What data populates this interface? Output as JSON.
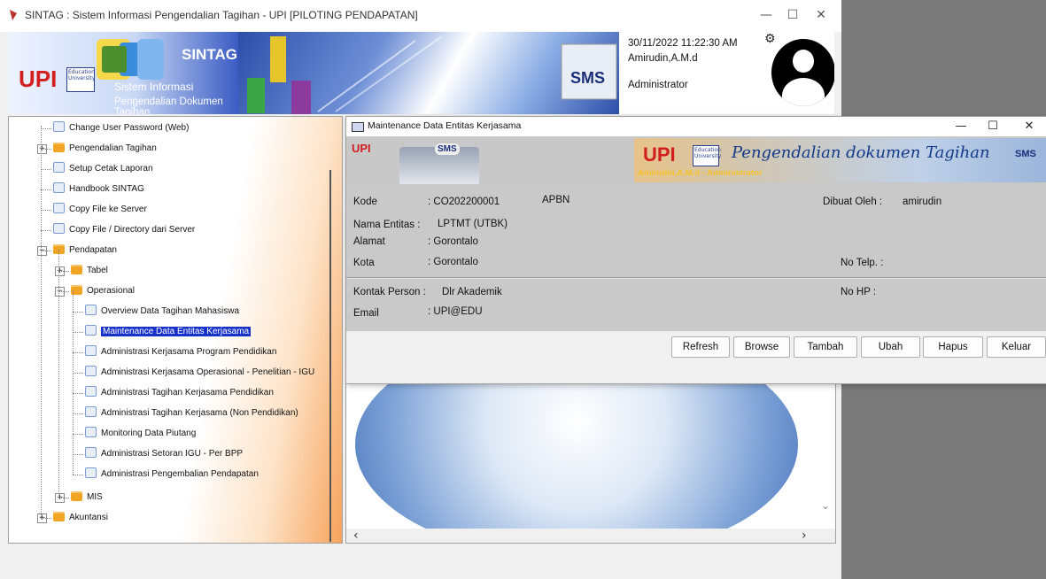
{
  "window": {
    "title": "SINTAG : Sistem Informasi Pengendalian Tagihan - UPI [PILOTING PENDAPATAN]",
    "minimize": "—",
    "maximize": "☐",
    "close": "✕"
  },
  "header": {
    "brand": "SINTAG",
    "upi_logo": "UPI",
    "upi_logo_sub": "Education University",
    "sub1": "Sistem Informasi",
    "sub2": "Pengendalian Dokumen Tagihan",
    "datetime": "30/11/2022 11:22:30 AM",
    "user": "Amirudin,A.M.d",
    "role": "Administrator",
    "gear_icon": "gear-icon",
    "avatar_icon": "user-avatar-icon"
  },
  "tree": {
    "items": [
      {
        "label": "Change User Password (Web)",
        "type": "page"
      },
      {
        "label": "Pengendalian Tagihan",
        "type": "folder",
        "expander": "+"
      },
      {
        "label": "Setup Cetak Laporan",
        "type": "page"
      },
      {
        "label": "Handbook SINTAG",
        "type": "page"
      },
      {
        "label": "Copy File ke Server",
        "type": "page"
      },
      {
        "label": "Copy File / Directory dari Server",
        "type": "page"
      },
      {
        "label": "Pendapatan",
        "type": "folder",
        "expander": "−"
      },
      {
        "label": "Tabel",
        "type": "folder",
        "expander": "+"
      },
      {
        "label": "Operasional",
        "type": "folder",
        "expander": "−"
      },
      {
        "label": "Overview Data Tagihan Mahasiswa",
        "type": "page"
      },
      {
        "label": "Maintenance Data Entitas Kerjasama",
        "type": "page",
        "selected": true
      },
      {
        "label": "Administrasi Kerjasama Program Pendidikan",
        "type": "page"
      },
      {
        "label": "Administrasi Kerjasama Operasional - Penelitian - IGU",
        "type": "page"
      },
      {
        "label": "Administrasi Tagihan Kerjasama Pendidikan",
        "type": "page"
      },
      {
        "label": "Administrasi Tagihan Kerjasama (Non Pendidikan)",
        "type": "page"
      },
      {
        "label": "Monitoring Data Piutang",
        "type": "page"
      },
      {
        "label": "Administrasi Setoran IGU - Per BPP",
        "type": "page"
      },
      {
        "label": "Administrasi Pengembalian Pendapatan",
        "type": "page"
      },
      {
        "label": "MIS",
        "type": "folder",
        "expander": "+"
      },
      {
        "label": "Akuntansi",
        "type": "folder",
        "expander": "+"
      }
    ]
  },
  "dialog": {
    "title": "Maintenance Data Entitas Kerjasama",
    "minimize": "—",
    "maximize": "☐",
    "close": "✕",
    "banner": {
      "upi_logo": "UPI",
      "upi_logo_sub": "Education University",
      "sms_logo": "SMS",
      "tagline": "Pengendalian dokumen Tagihan",
      "user_line": "Amirudin,A.M.d - Administrator"
    },
    "fields": {
      "kode_label": "Kode",
      "kode_value": ": CO202200001",
      "apbn": "APBN",
      "dibuat_oleh_label": "Dibuat Oleh :",
      "dibuat_oleh_value": "amirudin",
      "nama_label": "Nama  Entitas :",
      "nama_value": "LPTMT (UTBK)",
      "alamat_label": "Alamat",
      "alamat_value": ": Gorontalo",
      "kota_label": "Kota",
      "kota_value": ": Gorontalo",
      "telp_label": "No Telp. :",
      "kontak_label": "Kontak Person :",
      "kontak_value": "Dlr Akademik",
      "hp_label": "No HP   :",
      "email_label": "Email",
      "email_value": ": UPI@EDU"
    },
    "buttons": [
      "Refresh",
      "Browse",
      "Tambah",
      "Ubah",
      "Hapus",
      "Keluar"
    ]
  },
  "colors": {
    "selected_bg": "#1732c8",
    "folder": "#f2a425",
    "header_blue": "#2b4bb0",
    "brand_red": "#d21e1e"
  }
}
